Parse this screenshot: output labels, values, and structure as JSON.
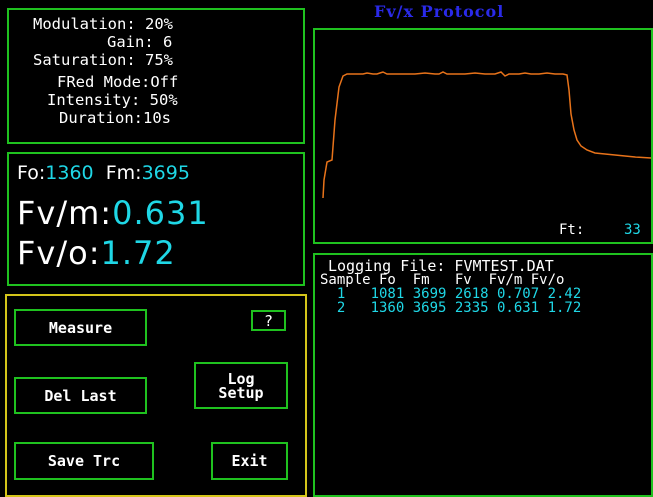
{
  "title": "Fv/x Protocol",
  "settings": {
    "modulation": "Modulation: 20%",
    "gain": "Gain: 6",
    "saturation": "Saturation: 75%",
    "fred_mode": "FRed Mode:Off",
    "intensity": "Intensity: 50%",
    "duration": "Duration:10s"
  },
  "readout": {
    "fo_label": "Fo:",
    "fo_value": "1360",
    "fm_label": "Fm:",
    "fm_value": "3695",
    "fvm_label": "Fv/m:",
    "fvm_value": "0.631",
    "fvo_label": "Fv/o:",
    "fvo_value": "1.72"
  },
  "controls": {
    "help": "?",
    "measure": "Measure",
    "del_last": "Del Last",
    "log_setup_line1": "Log",
    "log_setup_line2": "Setup",
    "save_trc": "Save Trc",
    "exit": "Exit"
  },
  "trace": {
    "ft_label": "Ft:",
    "ft_value": "33",
    "color": "#e8731a"
  },
  "log": {
    "file_line": "Logging File: FVMTEST.DAT",
    "header": "Sample Fo  Fm   Fv  Fv/m Fv/o",
    "rows": [
      "  1   1081 3699 2618 0.707 2.42",
      "  2   1360 3695 2335 0.631 1.72"
    ]
  },
  "colors": {
    "panel_border": "#1fc11f",
    "controls_border": "#d4c51a",
    "value_cyan": "#1fd7e6",
    "title_blue": "#2a2ae8"
  }
}
